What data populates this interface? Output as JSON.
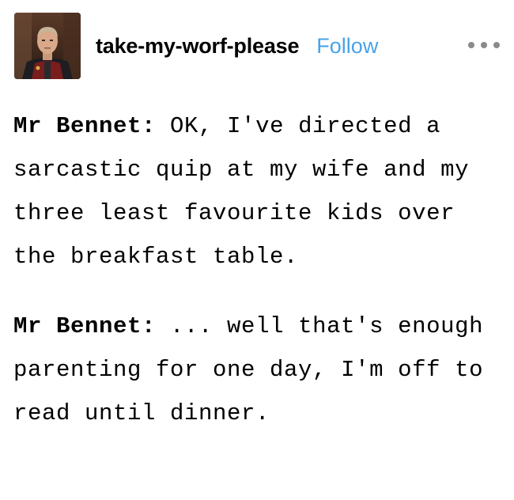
{
  "post": {
    "author": {
      "username": "take-my-worf-please",
      "follow_label": "Follow",
      "avatar_icon": "avatar-image"
    },
    "more_icon": "more-options-icon",
    "chat": [
      {
        "speaker": "Mr Bennet:",
        "text": "OK, I've directed a sarcastic quip at my wife and my three least favourite kids over the breakfast table."
      },
      {
        "speaker": "Mr Bennet:",
        "text": "... well that's enough parenting for one day, I'm off to read until dinner."
      }
    ]
  },
  "colors": {
    "follow": "#4aa3e8",
    "text": "#000000",
    "dots": "#8a8a8a",
    "background": "#ffffff"
  }
}
